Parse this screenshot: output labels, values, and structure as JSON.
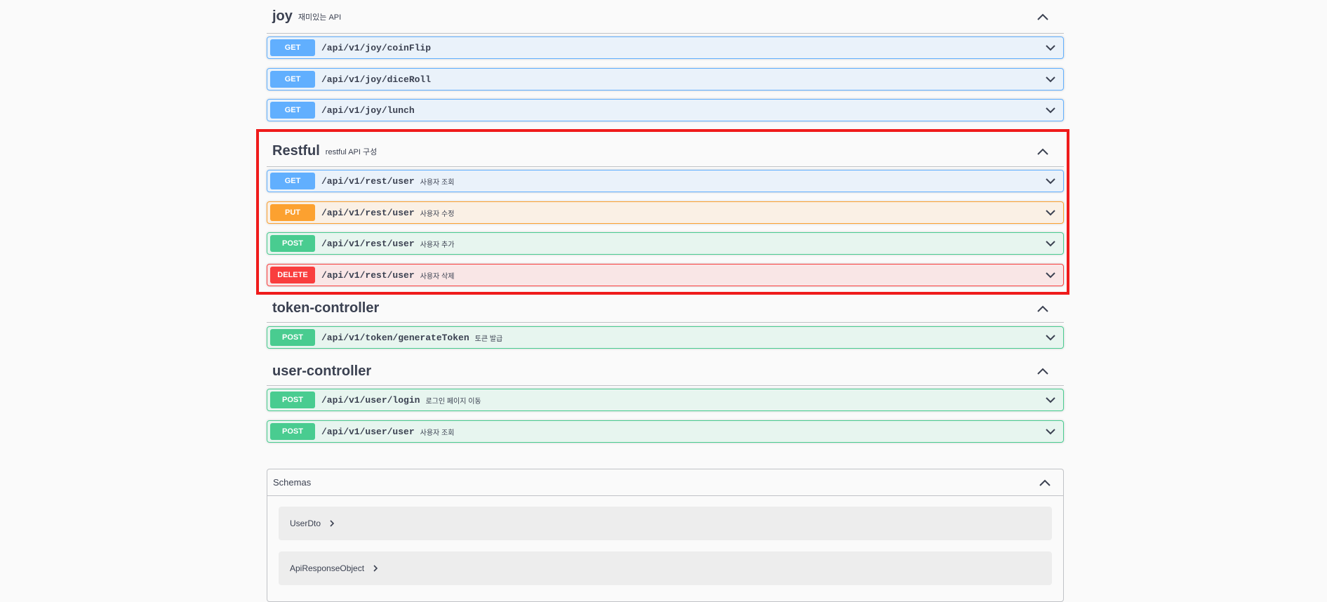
{
  "tags": [
    {
      "name": "joy",
      "description": "재미있는 API",
      "operations": [
        {
          "method": "GET",
          "path": "/api/v1/joy/coinFlip",
          "summary": ""
        },
        {
          "method": "GET",
          "path": "/api/v1/joy/diceRoll",
          "summary": ""
        },
        {
          "method": "GET",
          "path": "/api/v1/joy/lunch",
          "summary": ""
        }
      ]
    },
    {
      "name": "Restful",
      "description": "restful API 구성",
      "operations": [
        {
          "method": "GET",
          "path": "/api/v1/rest/user",
          "summary": "사용자 조회"
        },
        {
          "method": "PUT",
          "path": "/api/v1/rest/user",
          "summary": "사용자 수정"
        },
        {
          "method": "POST",
          "path": "/api/v1/rest/user",
          "summary": "사용자 추가"
        },
        {
          "method": "DELETE",
          "path": "/api/v1/rest/user",
          "summary": "사용자 삭제"
        }
      ]
    },
    {
      "name": "token-controller",
      "description": "",
      "operations": [
        {
          "method": "POST",
          "path": "/api/v1/token/generateToken",
          "summary": "토큰 발급"
        }
      ]
    },
    {
      "name": "user-controller",
      "description": "",
      "operations": [
        {
          "method": "POST",
          "path": "/api/v1/user/login",
          "summary": "로그인 페이지 이동"
        },
        {
          "method": "POST",
          "path": "/api/v1/user/user",
          "summary": "사용자 조회"
        }
      ]
    }
  ],
  "schemas": {
    "title": "Schemas",
    "models": [
      "UserDto",
      "ApiResponseObject"
    ]
  },
  "icons": {
    "collapse": "chevron-up-icon",
    "expand_op": "chevron-down-icon",
    "model_expand": "chevron-right-icon"
  },
  "colors": {
    "get": "#61affe",
    "put": "#fca130",
    "post": "#49cc90",
    "delete": "#f93e3e",
    "highlight": "#ef1b1b"
  }
}
